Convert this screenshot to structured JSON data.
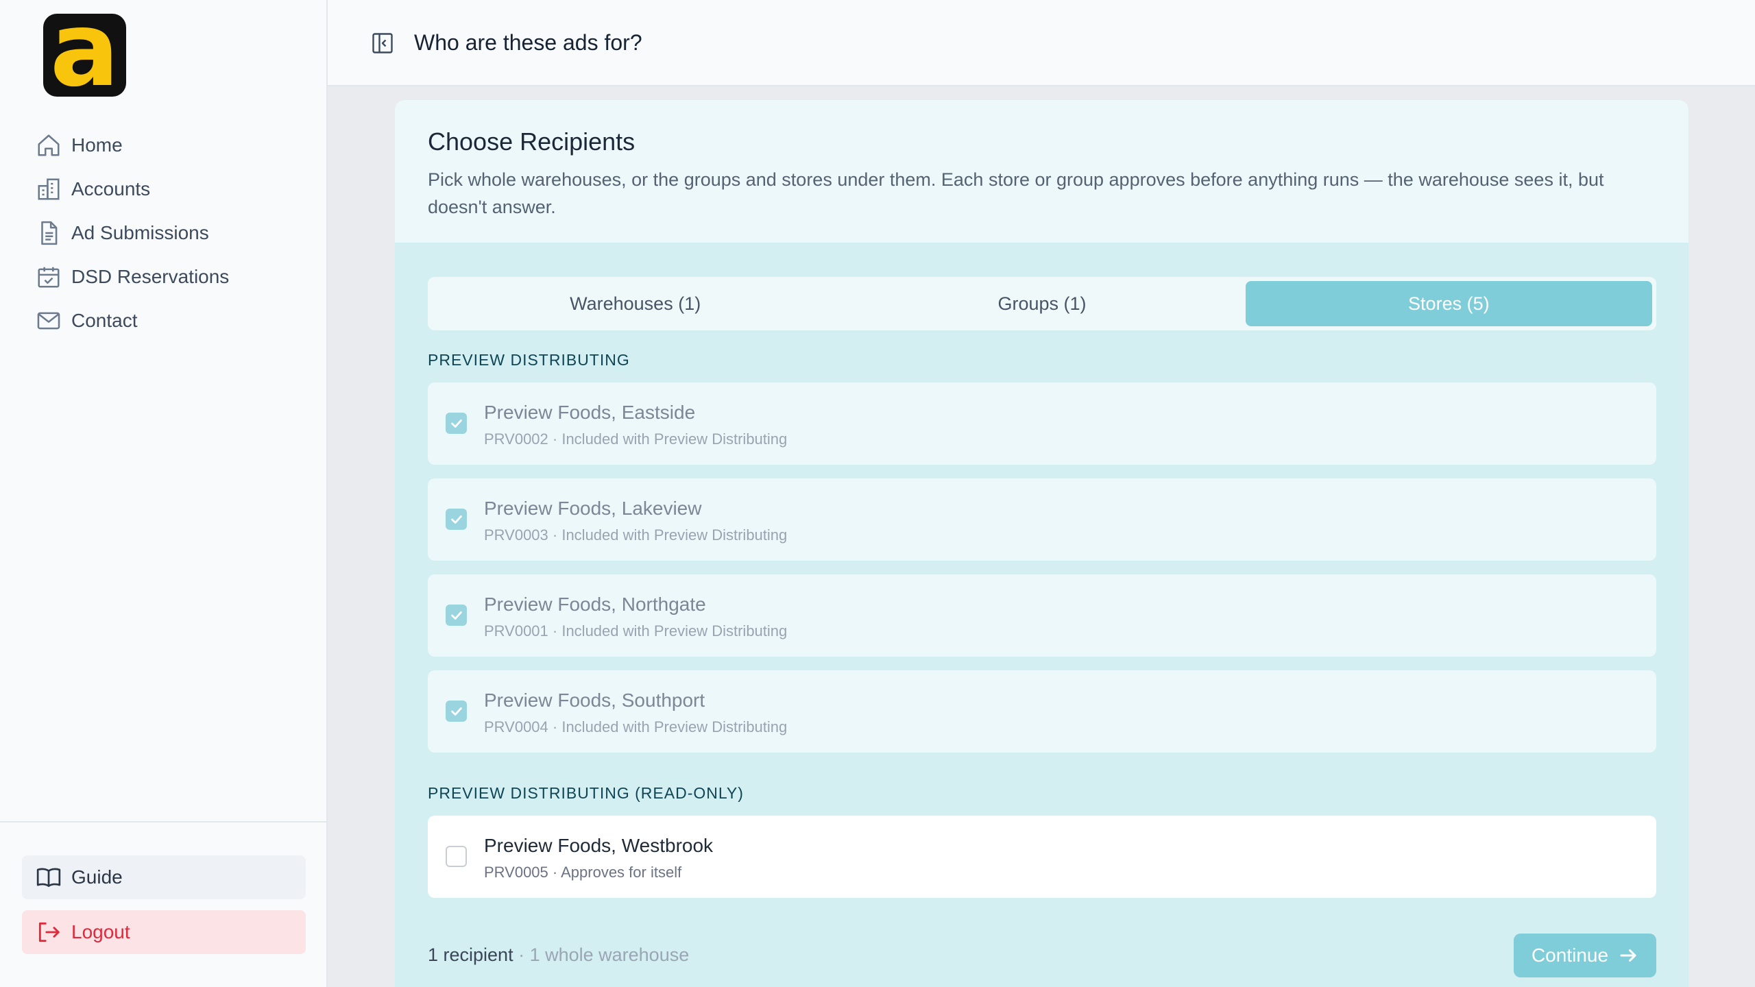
{
  "brand": {
    "logo_letter": "a"
  },
  "sidebar": {
    "items": [
      {
        "label": "Home",
        "icon": "home-icon"
      },
      {
        "label": "Accounts",
        "icon": "building-icon"
      },
      {
        "label": "Ad Submissions",
        "icon": "document-icon"
      },
      {
        "label": "DSD Reservations",
        "icon": "calendar-check-icon"
      },
      {
        "label": "Contact",
        "icon": "mail-icon"
      }
    ],
    "guide_label": "Guide",
    "logout_label": "Logout"
  },
  "header": {
    "title": "Who are these ads for?"
  },
  "card": {
    "title": "Choose Recipients",
    "description": "Pick whole warehouses, or the groups and stores under them. Each store or group approves before anything runs — the warehouse sees it, but doesn't answer."
  },
  "tabs": [
    {
      "label": "Warehouses (1)",
      "active": false
    },
    {
      "label": "Groups (1)",
      "active": false
    },
    {
      "label": "Stores (5)",
      "active": true
    }
  ],
  "sections": [
    {
      "label": "Preview Distributing",
      "rows": [
        {
          "name": "Preview Foods, Eastside",
          "sub": "PRV0002 · Included with Preview Distributing",
          "checked": true
        },
        {
          "name": "Preview Foods, Lakeview",
          "sub": "PRV0003 · Included with Preview Distributing",
          "checked": true
        },
        {
          "name": "Preview Foods, Northgate",
          "sub": "PRV0001 · Included with Preview Distributing",
          "checked": true
        },
        {
          "name": "Preview Foods, Southport",
          "sub": "PRV0004 · Included with Preview Distributing",
          "checked": true
        }
      ]
    },
    {
      "label": "Preview Distributing (read-only)",
      "rows": [
        {
          "name": "Preview Foods, Westbrook",
          "sub": "PRV0005 · Approves for itself",
          "checked": false
        }
      ]
    }
  ],
  "footer": {
    "count": "1 recipient",
    "separator": " · ",
    "detail": "1 whole warehouse",
    "continue_label": "Continue"
  },
  "colors": {
    "accent": "#7fcdd9",
    "logo_bg": "#111111",
    "logo_fg": "#f8c40c",
    "logout": "#e02a3c"
  }
}
